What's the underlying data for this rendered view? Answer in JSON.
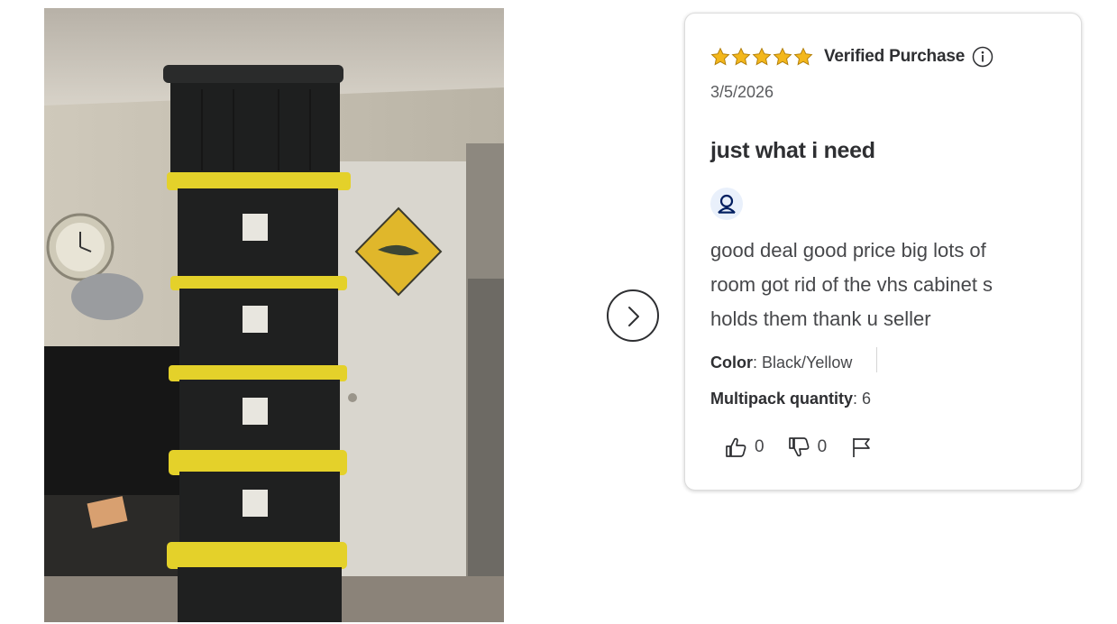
{
  "photo": {
    "alt": ""
  },
  "navigation": {
    "next_icon": "chevron-right-icon"
  },
  "review": {
    "rating": 5,
    "rating_max": 5,
    "verified_label": "Verified Purchase",
    "date": "3/5/2026",
    "title": "just what i need",
    "body": "good deal good price big lots of room got rid of the vhs cabinet s holds them thank u seller",
    "attributes": {
      "color_label": "Color",
      "color_value": "Black/Yellow",
      "qty_label": "Multipack quantity",
      "qty_value": "6"
    },
    "helpful_count": "0",
    "unhelpful_count": "0"
  },
  "colors": {
    "star": "#f3b71b",
    "text": "#2e2f32",
    "avatar_bg": "#e9f0fb",
    "avatar_icon": "#001e60"
  }
}
